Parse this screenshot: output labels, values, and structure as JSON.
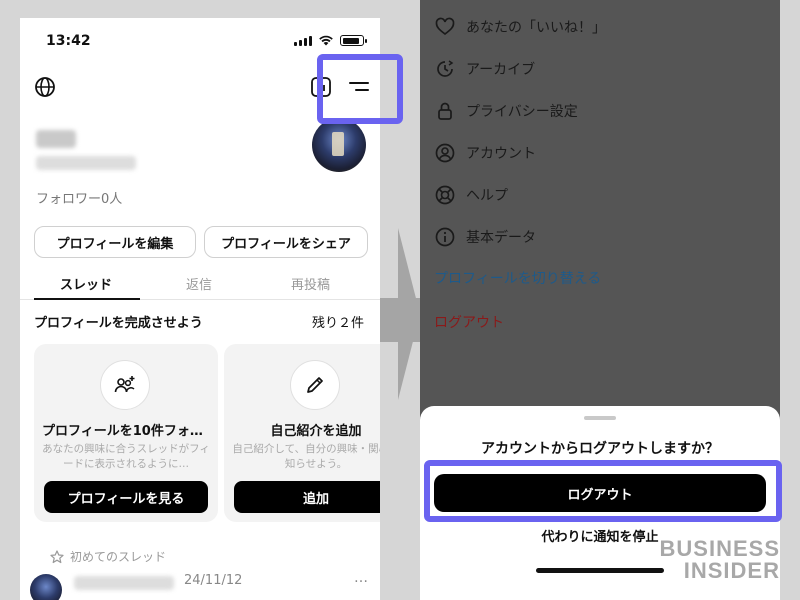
{
  "status_bar": {
    "time": "13:42",
    "battery_level": 0.85
  },
  "profile": {
    "followers": "フォロワー0人",
    "edit_button": "プロフィールを編集",
    "share_button": "プロフィールをシェア"
  },
  "tabs": [
    {
      "label": "スレッド",
      "active": true
    },
    {
      "label": "返信",
      "active": false
    },
    {
      "label": "再投稿",
      "active": false
    }
  ],
  "complete_section": {
    "title": "プロフィールを完成させよう",
    "remaining": "残り２件"
  },
  "cards": [
    {
      "icon": "add-people-icon",
      "title": "プロフィールを10件フォロー",
      "description": "あなたの興味に合うスレッドがフィードに表示されるように…",
      "button": "プロフィールを見る"
    },
    {
      "icon": "pencil-icon",
      "title": "自己紹介を追加",
      "description": "自己紹介して、自分の興味・関心を知らせよう。",
      "button": "追加"
    }
  ],
  "first_thread": {
    "label": "初めてのスレッド",
    "date": "24/11/12",
    "more": "…"
  },
  "menu": {
    "items": [
      {
        "label": "あなたの「いいね！」",
        "icon": "heart-icon"
      },
      {
        "label": "アーカイブ",
        "icon": "archive-icon"
      },
      {
        "label": "プライバシー設定",
        "icon": "lock-icon"
      },
      {
        "label": "アカウント",
        "icon": "account-icon"
      },
      {
        "label": "ヘルプ",
        "icon": "help-icon"
      },
      {
        "label": "基本データ",
        "icon": "info-icon"
      }
    ],
    "switch_profile": "プロフィールを切り替える",
    "logout": "ログアウト"
  },
  "logout_sheet": {
    "title": "アカウントからログアウトしますか？",
    "logout_button": "ログアウト",
    "stop_notifications": "代わりに通知を停止"
  },
  "watermark": {
    "line1": "BUSINESS",
    "line2": "INSIDER"
  },
  "colors": {
    "highlight": "#6a63f0",
    "switch_profile": "#1e5a8a",
    "logout": "#8a1a1a",
    "overlay": "#555555"
  }
}
